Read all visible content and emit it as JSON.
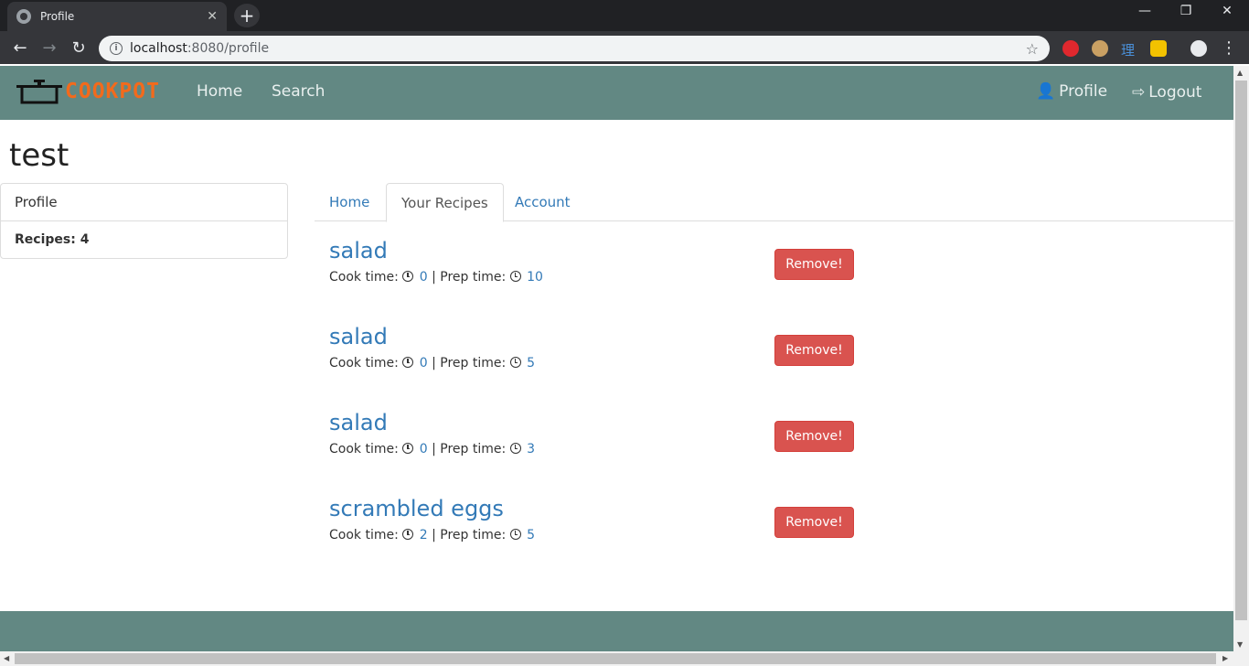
{
  "browser": {
    "tab_title": "Profile",
    "url_host": "localhost",
    "url_rest": ":8080/profile",
    "new_tab": "+",
    "close_tab": "✕",
    "minimize": "—",
    "restore": "❐",
    "close_window": "✕",
    "back": "←",
    "forward": "→",
    "reload": "↻",
    "bookmark_star": "☆",
    "menu": "⋮"
  },
  "navbar": {
    "brand": "COOKPOT",
    "home": "Home",
    "search": "Search",
    "profile": "Profile",
    "logout": "Logout"
  },
  "user": {
    "name": "test"
  },
  "sidebar": {
    "heading": "Profile",
    "recipes_count": "Recipes: 4"
  },
  "tabs": [
    {
      "label": "Home",
      "active": false
    },
    {
      "label": "Your Recipes",
      "active": true
    },
    {
      "label": "Account",
      "active": false
    }
  ],
  "recipe_labels": {
    "cook": "Cook time:",
    "prep": "| Prep time:",
    "remove": "Remove!"
  },
  "recipes": [
    {
      "name": "salad",
      "cook_time": "0",
      "prep_time": "10"
    },
    {
      "name": "salad",
      "cook_time": "0",
      "prep_time": "5"
    },
    {
      "name": "salad",
      "cook_time": "0",
      "prep_time": "3"
    },
    {
      "name": "scrambled eggs",
      "cook_time": "2",
      "prep_time": "5"
    }
  ],
  "colors": {
    "navbar_bg": "#628883",
    "brand_orange": "#f36a1c",
    "link_blue": "#337ab7",
    "danger_red": "#d9534f"
  }
}
